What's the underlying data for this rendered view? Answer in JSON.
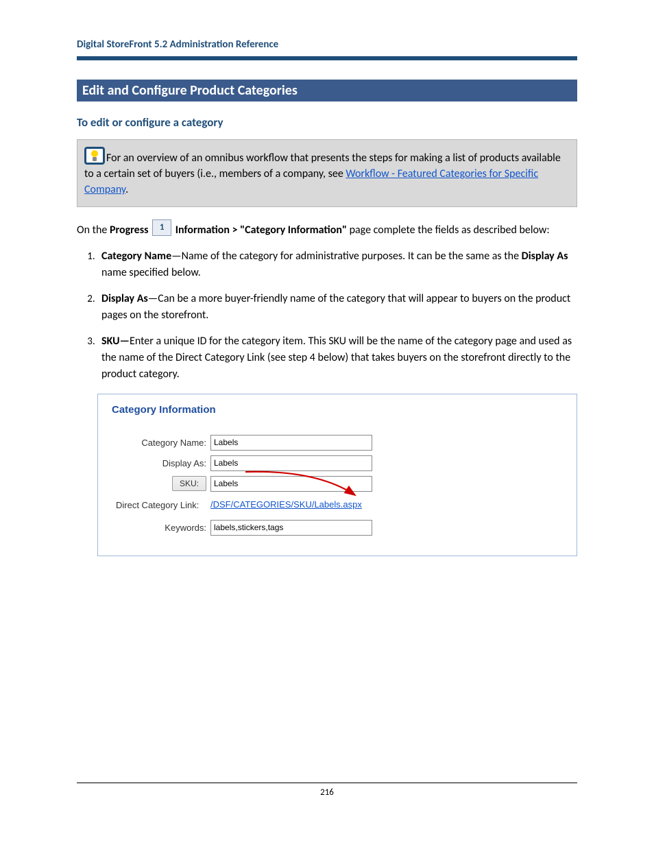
{
  "header": {
    "doc_title": "Digital StoreFront 5.2 Administration Reference"
  },
  "section": {
    "title": "Edit and Configure Product Categories",
    "subheading": "To edit or configure a category"
  },
  "callout": {
    "intro": "For an overview of an omnibus workflow that presents the steps for making a list of products available to a certain set of buyers (i.e., members of a company, see ",
    "link_text": "Workflow - Featured Categories for Specific Company",
    "suffix": "."
  },
  "intro_para": {
    "pre": "On the ",
    "progress_label": "Progress",
    "step_number": "1",
    "continuation": "Information > \"Category Information\"",
    "rest": " page complete the fields as described below:"
  },
  "steps": [
    {
      "term": "Category Name",
      "dash": "—",
      "text_a": "Name of the category for administrative purposes. It can be the same as the ",
      "inner_bold": "Display As",
      "text_b": " name specified below."
    },
    {
      "term": "Display As",
      "dash": "—",
      "text_a": "Can be a more buyer-friendly name of the category that will appear to buyers on the product pages on the storefront.",
      "inner_bold": "",
      "text_b": ""
    },
    {
      "term": "SKU—",
      "dash": "",
      "text_a": "Enter a unique ID for the category item. This SKU will be the name of the category page and used as the name of the Direct Category Link (see step 4 below) that takes buyers on the storefront directly to the product category.",
      "inner_bold": "",
      "text_b": ""
    }
  ],
  "form": {
    "title": "Category Information",
    "labels": {
      "category_name": "Category Name:",
      "display_as": "Display As:",
      "sku": "SKU:",
      "direct_link": "Direct Category Link:",
      "keywords": "Keywords:"
    },
    "values": {
      "category_name": "Labels",
      "display_as": "Labels",
      "sku": "Labels",
      "direct_link": "/DSF/CATEGORIES/SKU/Labels.aspx",
      "keywords": "labels,stickers,tags"
    }
  },
  "page_number": "216"
}
